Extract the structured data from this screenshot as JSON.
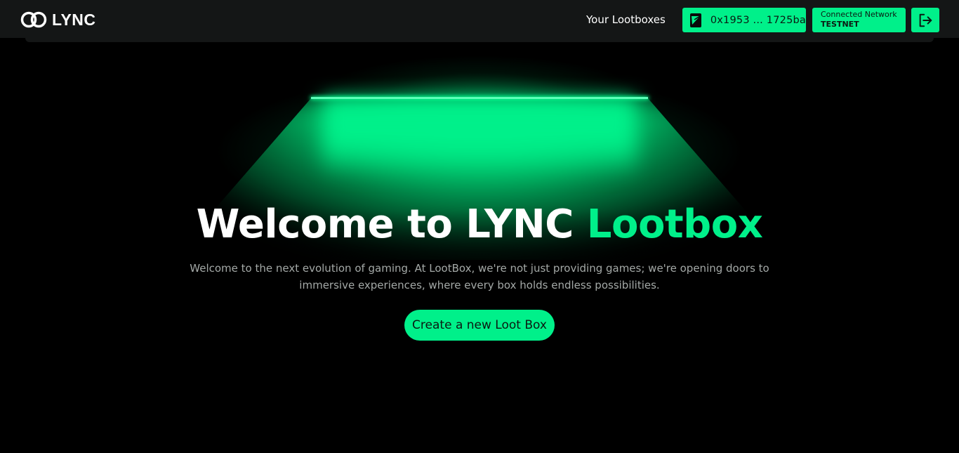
{
  "brand": {
    "name": "LYNC"
  },
  "nav": {
    "lootboxes_link": "Your Lootboxes",
    "wallet_address": "0x1953 ... 1725ba",
    "network_label": "Connected Network",
    "network_value": "TESTNET",
    "logout_icon": "logout-icon"
  },
  "hero": {
    "title_main": "Welcome to LYNC ",
    "title_accent": "Lootbox",
    "description": "Welcome to the next evolution of gaming. At LootBox, we're not just providing games; we're opening doors to immersive experiences, where every box holds endless possibilities.",
    "cta_label": "Create a new Loot Box"
  },
  "colors": {
    "accent": "#00f08a",
    "background": "#000000",
    "navbar": "#141616",
    "muted_text": "#a4a9a7"
  }
}
